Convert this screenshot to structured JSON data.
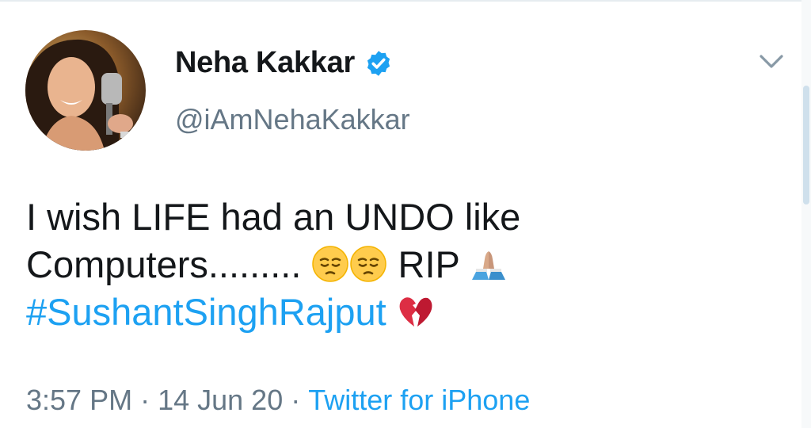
{
  "author": {
    "display_name": "Neha Kakkar",
    "handle": "@iAmNehaKakkar",
    "verified": true
  },
  "tweet": {
    "line1": "I wish LIFE had an UNDO like",
    "line2_text": "Computers.........",
    "line2_rip": "RIP",
    "hashtag": "#SushantSinghRajput",
    "emojis": [
      "pensive-face-emoji",
      "pensive-face-emoji",
      "folded-hands-emoji",
      "broken-heart-emoji"
    ]
  },
  "meta": {
    "time": "3:57 PM",
    "date": "14 Jun 20",
    "separator": "·",
    "source": "Twitter for iPhone"
  },
  "colors": {
    "link": "#1da1f2",
    "secondary_text": "#657786",
    "primary_text": "#14171a"
  }
}
